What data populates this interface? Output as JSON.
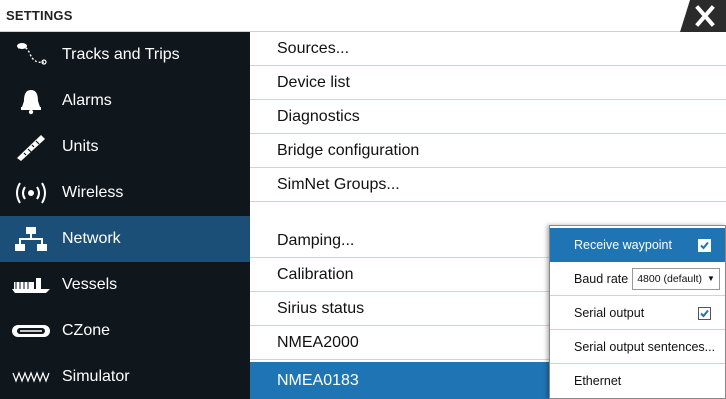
{
  "title": "SETTINGS",
  "sidebar": {
    "items": [
      {
        "label": "Tracks and Trips",
        "icon": "tracks-icon"
      },
      {
        "label": "Alarms",
        "icon": "bell-icon"
      },
      {
        "label": "Units",
        "icon": "ruler-icon"
      },
      {
        "label": "Wireless",
        "icon": "wireless-icon"
      },
      {
        "label": "Network",
        "icon": "network-icon",
        "active": true
      },
      {
        "label": "Vessels",
        "icon": "vessels-icon"
      },
      {
        "label": "CZone",
        "icon": "czone-icon"
      },
      {
        "label": "Simulator",
        "icon": "simulator-icon"
      }
    ]
  },
  "main": {
    "items": [
      {
        "label": "Sources..."
      },
      {
        "label": "Device list"
      },
      {
        "label": "Diagnostics"
      },
      {
        "label": "Bridge configuration"
      },
      {
        "label": "SimNet Groups..."
      },
      {
        "label": "Damping..."
      },
      {
        "label": "Calibration"
      },
      {
        "label": "Sirius status"
      },
      {
        "label": "NMEA2000"
      },
      {
        "label": "NMEA0183",
        "active": true
      }
    ]
  },
  "popup": {
    "receive_waypoint": {
      "label": "Receive waypoint",
      "checked": true
    },
    "baud_rate": {
      "label": "Baud rate",
      "value": "4800 (default)"
    },
    "serial_output": {
      "label": "Serial output",
      "checked": true
    },
    "serial_output_sentences": {
      "label": "Serial output sentences..."
    },
    "ethernet": {
      "label": "Ethernet"
    }
  },
  "colors": {
    "sidebar_bg": "#0f161c",
    "active_sidebar": "#1b4f78",
    "accent": "#1f74b4"
  }
}
